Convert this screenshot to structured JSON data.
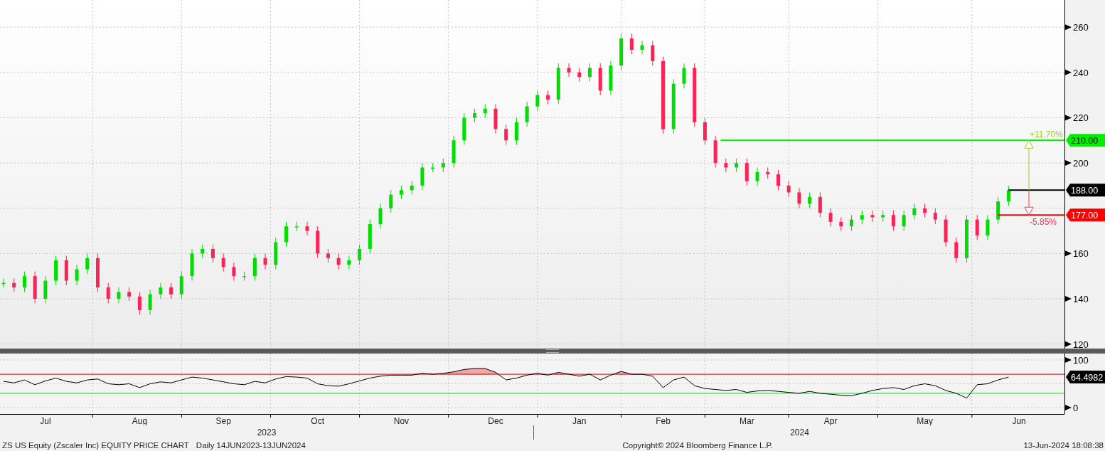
{
  "price_chart": {
    "chart_data": {
      "type": "candlestick",
      "categories": [
        null,
        null,
        null,
        null,
        null,
        null,
        null,
        null,
        null,
        null,
        null,
        null,
        null,
        null,
        null,
        null,
        null,
        null,
        null,
        null,
        null,
        null,
        null,
        null,
        null,
        null,
        null,
        null,
        null,
        null,
        null,
        null,
        null,
        null,
        null,
        null,
        null,
        null,
        null,
        null,
        null,
        null,
        null,
        null,
        null,
        null,
        null,
        null,
        null,
        null,
        null,
        null,
        null,
        null,
        null,
        null,
        null,
        null,
        null,
        null,
        null,
        null,
        null,
        null,
        null,
        null,
        null,
        null,
        null,
        null,
        null,
        null,
        null,
        null,
        null,
        null,
        null,
        null,
        null,
        null,
        null,
        null,
        null,
        null,
        null,
        null,
        null,
        null,
        null,
        null,
        null,
        null,
        null,
        null,
        null,
        null,
        null,
        null,
        null,
        null,
        null,
        null
      ],
      "ohlc": [
        [
          147,
          149,
          145,
          147
        ],
        [
          147,
          149,
          143,
          145
        ],
        [
          145,
          152,
          143,
          150
        ],
        [
          150,
          152,
          138,
          140
        ],
        [
          140,
          150,
          138,
          148
        ],
        [
          148,
          159,
          146,
          157
        ],
        [
          157,
          159,
          146,
          148
        ],
        [
          148,
          155,
          146,
          153
        ],
        [
          153,
          160,
          151,
          158
        ],
        [
          158,
          160,
          143,
          145
        ],
        [
          145,
          147,
          138,
          140
        ],
        [
          140,
          145,
          138,
          143
        ],
        [
          143,
          145,
          139,
          141
        ],
        [
          141,
          143,
          133,
          135
        ],
        [
          135,
          144,
          133,
          142
        ],
        [
          142,
          147,
          140,
          145
        ],
        [
          145,
          147,
          140,
          142
        ],
        [
          142,
          152,
          140,
          150
        ],
        [
          150,
          162,
          148,
          160
        ],
        [
          160,
          164,
          158,
          162
        ],
        [
          162,
          164,
          156,
          158
        ],
        [
          158,
          160,
          152,
          154
        ],
        [
          154,
          156,
          148,
          150
        ],
        [
          150,
          152,
          148,
          150
        ],
        [
          150,
          160,
          148,
          158
        ],
        [
          158,
          160,
          153,
          155
        ],
        [
          155,
          167,
          153,
          165
        ],
        [
          165,
          174,
          163,
          172
        ],
        [
          172,
          174,
          170,
          172
        ],
        [
          172,
          174,
          168,
          170
        ],
        [
          170,
          172,
          158,
          160
        ],
        [
          160,
          162,
          156,
          158
        ],
        [
          158,
          160,
          153,
          155
        ],
        [
          155,
          159,
          153,
          157
        ],
        [
          157,
          164,
          155,
          162
        ],
        [
          162,
          175,
          160,
          173
        ],
        [
          173,
          182,
          171,
          180
        ],
        [
          180,
          188,
          178,
          186
        ],
        [
          186,
          190,
          184,
          188
        ],
        [
          188,
          192,
          186,
          190
        ],
        [
          190,
          200,
          188,
          198
        ],
        [
          198,
          200,
          196,
          198
        ],
        [
          198,
          202,
          196,
          200
        ],
        [
          200,
          212,
          198,
          210
        ],
        [
          210,
          222,
          208,
          220
        ],
        [
          220,
          224,
          218,
          222
        ],
        [
          222,
          226,
          220,
          224
        ],
        [
          224,
          226,
          213,
          215
        ],
        [
          215,
          217,
          208,
          210
        ],
        [
          210,
          220,
          208,
          218
        ],
        [
          218,
          227,
          216,
          225
        ],
        [
          225,
          232,
          223,
          230
        ],
        [
          230,
          232,
          226,
          228
        ],
        [
          228,
          244,
          226,
          242
        ],
        [
          242,
          244,
          238,
          240
        ],
        [
          240,
          242,
          236,
          238
        ],
        [
          238,
          244,
          236,
          242
        ],
        [
          242,
          244,
          230,
          232
        ],
        [
          232,
          245,
          230,
          243
        ],
        [
          243,
          257,
          241,
          255
        ],
        [
          255,
          257,
          248,
          250
        ],
        [
          250,
          254,
          248,
          252
        ],
        [
          252,
          254,
          243,
          245
        ],
        [
          245,
          247,
          213,
          215
        ],
        [
          215,
          237,
          213,
          235
        ],
        [
          235,
          244,
          233,
          242
        ],
        [
          242,
          244,
          216,
          218
        ],
        [
          218,
          220,
          208,
          210
        ],
        [
          210,
          212,
          198,
          200
        ],
        [
          200,
          202,
          196,
          198
        ],
        [
          198,
          202,
          196,
          200
        ],
        [
          200,
          202,
          190,
          192
        ],
        [
          192,
          198,
          190,
          196
        ],
        [
          196,
          198,
          193,
          195
        ],
        [
          195,
          197,
          188,
          190
        ],
        [
          190,
          192,
          185,
          187
        ],
        [
          187,
          189,
          180,
          182
        ],
        [
          182,
          187,
          180,
          185
        ],
        [
          185,
          187,
          176,
          178
        ],
        [
          178,
          180,
          172,
          174
        ],
        [
          174,
          176,
          170,
          172
        ],
        [
          172,
          177,
          170,
          175
        ],
        [
          175,
          179,
          173,
          177
        ],
        [
          177,
          179,
          174,
          176
        ],
        [
          176,
          179,
          174,
          177
        ],
        [
          177,
          179,
          170,
          172
        ],
        [
          172,
          179,
          170,
          177
        ],
        [
          177,
          182,
          175,
          180
        ],
        [
          180,
          182,
          176,
          178
        ],
        [
          178,
          180,
          173,
          175
        ],
        [
          175,
          177,
          163,
          165
        ],
        [
          165,
          167,
          156,
          158
        ],
        [
          158,
          177,
          156,
          175
        ],
        [
          175,
          177,
          166,
          168
        ],
        [
          168,
          177,
          166,
          175
        ],
        [
          175,
          185,
          173,
          183
        ],
        [
          183,
          190,
          181,
          188
        ],
        null,
        null,
        null,
        null,
        null
      ],
      "ylim": [
        118,
        272
      ],
      "grid": true,
      "yticks": [
        120,
        140,
        160,
        200,
        220,
        240,
        260
      ],
      "ref_lines": [
        {
          "axis": "y",
          "value": 210,
          "label": "210.00",
          "color": "#00ee00"
        },
        {
          "axis": "y",
          "value": 188,
          "label": "188.00",
          "color": "#000000"
        },
        {
          "axis": "y",
          "value": 177,
          "label": "177.00",
          "color": "#ff0000"
        }
      ],
      "annotations": [
        "+11.70%",
        "-5.85%"
      ]
    }
  },
  "rsi_chart": {
    "chart_data": {
      "type": "line",
      "categories": [
        null,
        null,
        null,
        null,
        "Jul",
        null,
        null,
        null,
        null,
        null,
        null,
        null,
        null,
        "Aug",
        null,
        null,
        null,
        null,
        null,
        null,
        null,
        "Sep",
        null,
        null,
        null,
        null,
        null,
        null,
        null,
        null,
        "Oct",
        null,
        null,
        null,
        null,
        null,
        null,
        null,
        "Nov",
        null,
        null,
        null,
        null,
        null,
        null,
        null,
        null,
        "Dec",
        null,
        null,
        null,
        null,
        null,
        null,
        null,
        "Jan",
        null,
        null,
        null,
        null,
        null,
        null,
        null,
        "Feb",
        null,
        null,
        null,
        null,
        null,
        null,
        null,
        "Mar",
        null,
        null,
        null,
        null,
        null,
        null,
        null,
        "Apr",
        null,
        null,
        null,
        null,
        null,
        null,
        null,
        null,
        "May",
        null,
        null,
        null,
        null,
        null,
        null,
        null,
        null,
        "Jun",
        null,
        null,
        null,
        null
      ],
      "series": [
        {
          "color": "#000000",
          "values": [
            55,
            52,
            58,
            48,
            56,
            62,
            55,
            52,
            58,
            60,
            50,
            48,
            50,
            42,
            50,
            54,
            52,
            58,
            64,
            62,
            58,
            54,
            50,
            48,
            55,
            52,
            60,
            65,
            64,
            62,
            50,
            46,
            45,
            50,
            56,
            62,
            66,
            68,
            68,
            68,
            72,
            70,
            72,
            75,
            80,
            82,
            82,
            74,
            58,
            62,
            68,
            72,
            68,
            74,
            70,
            66,
            70,
            58,
            68,
            76,
            70,
            70,
            66,
            42,
            58,
            64,
            46,
            40,
            38,
            36,
            38,
            32,
            35,
            36,
            34,
            32,
            30,
            34,
            30,
            28,
            26,
            25,
            30,
            36,
            40,
            42,
            38,
            46,
            50,
            46,
            36,
            30,
            20,
            48,
            50,
            58,
            64,
            null,
            null,
            null,
            null,
            null
          ]
        }
      ],
      "ylim": [
        -13.4,
        113.4
      ],
      "grid": true,
      "yticks": [
        0,
        100
      ],
      "ref_lines": [
        {
          "axis": "y",
          "value": 70,
          "color": "#cc0000"
        },
        {
          "axis": "y",
          "value": 30,
          "color": "#22cc22"
        }
      ],
      "annotations": [
        "64.4982"
      ]
    }
  },
  "years": [
    {
      "label": "2023"
    },
    {
      "label": "2024"
    }
  ],
  "footer": {
    "title": "ZS US Equity (Zscaler Inc) EQUITY PRICE CHART",
    "period": "Daily 14JUN2023-13JUN2024",
    "copyright": "Copyright© 2024 Bloomberg Finance L.P.",
    "timestamp": "13-Jun-2024 18:08:38"
  }
}
